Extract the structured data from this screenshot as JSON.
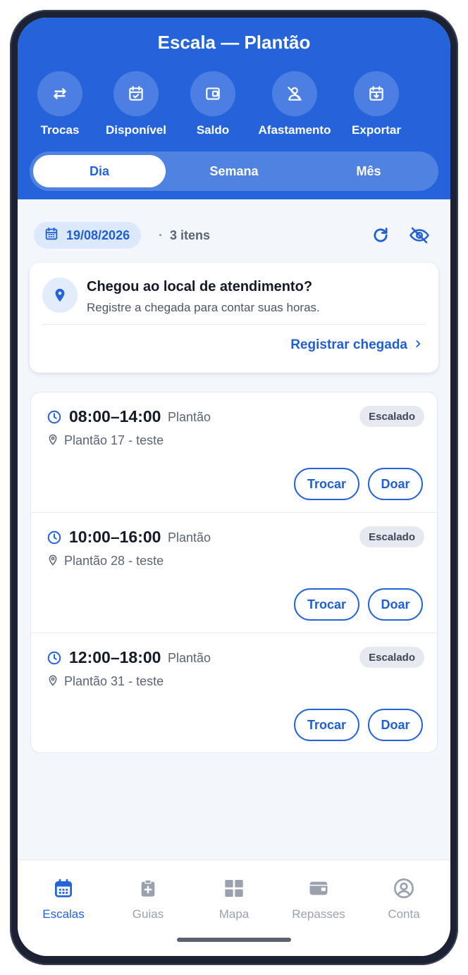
{
  "header": {
    "title": "Escala — Plantão",
    "actions": [
      {
        "label": "Trocas",
        "icon": "swap-arrows-icon"
      },
      {
        "label": "Disponível",
        "icon": "calendar-check-icon"
      },
      {
        "label": "Saldo",
        "icon": "wallet-icon"
      },
      {
        "label": "Afastamento",
        "icon": "user-off-icon"
      },
      {
        "label": "Exportar",
        "icon": "calendar-download-icon"
      }
    ],
    "tabs": [
      {
        "label": "Dia",
        "active": true
      },
      {
        "label": "Semana",
        "active": false
      },
      {
        "label": "Mês",
        "active": false
      }
    ]
  },
  "toolbar": {
    "date": "19/08/2026",
    "separator": "·",
    "count": "3 itens"
  },
  "arrival": {
    "title": "Chegou ao local de atendimento?",
    "subtitle": "Registre a chegada para contar suas horas.",
    "link": "Registrar chegada"
  },
  "shifts": [
    {
      "time": "08:00–14:00",
      "type": "Plantão",
      "status": "Escalado",
      "location": "Plantão 17 - teste",
      "swap_label": "Trocar",
      "donate_label": "Doar"
    },
    {
      "time": "10:00–16:00",
      "type": "Plantão",
      "status": "Escalado",
      "location": "Plantão 28 - teste",
      "swap_label": "Trocar",
      "donate_label": "Doar"
    },
    {
      "time": "12:00–18:00",
      "type": "Plantão",
      "status": "Escalado",
      "location": "Plantão 31 - teste",
      "swap_label": "Trocar",
      "donate_label": "Doar"
    }
  ],
  "bottom_nav": [
    {
      "label": "Escalas",
      "icon": "calendar-grid-icon",
      "active": true
    },
    {
      "label": "Guias",
      "icon": "clipboard-plus-icon",
      "active": false
    },
    {
      "label": "Mapa",
      "icon": "grid-map-icon",
      "active": false
    },
    {
      "label": "Repasses",
      "icon": "wallet-icon",
      "active": false
    },
    {
      "label": "Conta",
      "icon": "user-circle-icon",
      "active": false
    }
  ],
  "colors": {
    "primary": "#2563db",
    "background": "#f3f6fb",
    "text_dark": "#141a28",
    "text_muted": "#5b6475",
    "nav_inactive": "#9aa1ae"
  }
}
